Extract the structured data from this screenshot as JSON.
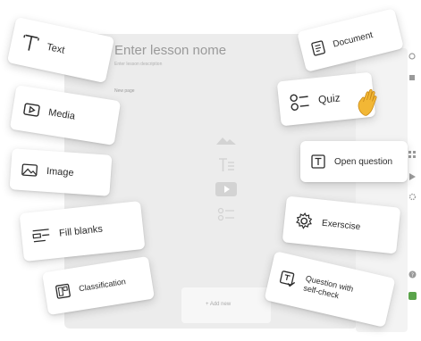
{
  "editor": {
    "title_placeholder": "Enter lesson nome",
    "description_placeholder": "Enter lesson description",
    "page_label": "New page",
    "add_button": "+ Add new"
  },
  "cards": {
    "text": "Text",
    "media": "Media",
    "image": "Image",
    "fill_blanks": "Fill blanks",
    "classification": "Classification",
    "document": "Document",
    "quiz": "Quiz",
    "open_question": "Open question",
    "exercise": "Exerscise",
    "question_self_check_line1": "Question with",
    "question_self_check_line2": "self-check"
  },
  "icons": {
    "text": "text-icon",
    "media": "play-icon",
    "image": "image-icon",
    "fill_blanks": "fill-blanks-icon",
    "classification": "classification-icon",
    "document": "document-icon",
    "quiz": "quiz-icon",
    "open_question": "text-box-icon",
    "exercise": "gear-icon",
    "question_self_check": "self-check-icon",
    "hand": "waving-hand-icon"
  },
  "colors": {
    "card_bg": "#ffffff",
    "editor_bg": "#ececec",
    "accent_green": "#5aa34a",
    "hand": "#f2b735"
  }
}
